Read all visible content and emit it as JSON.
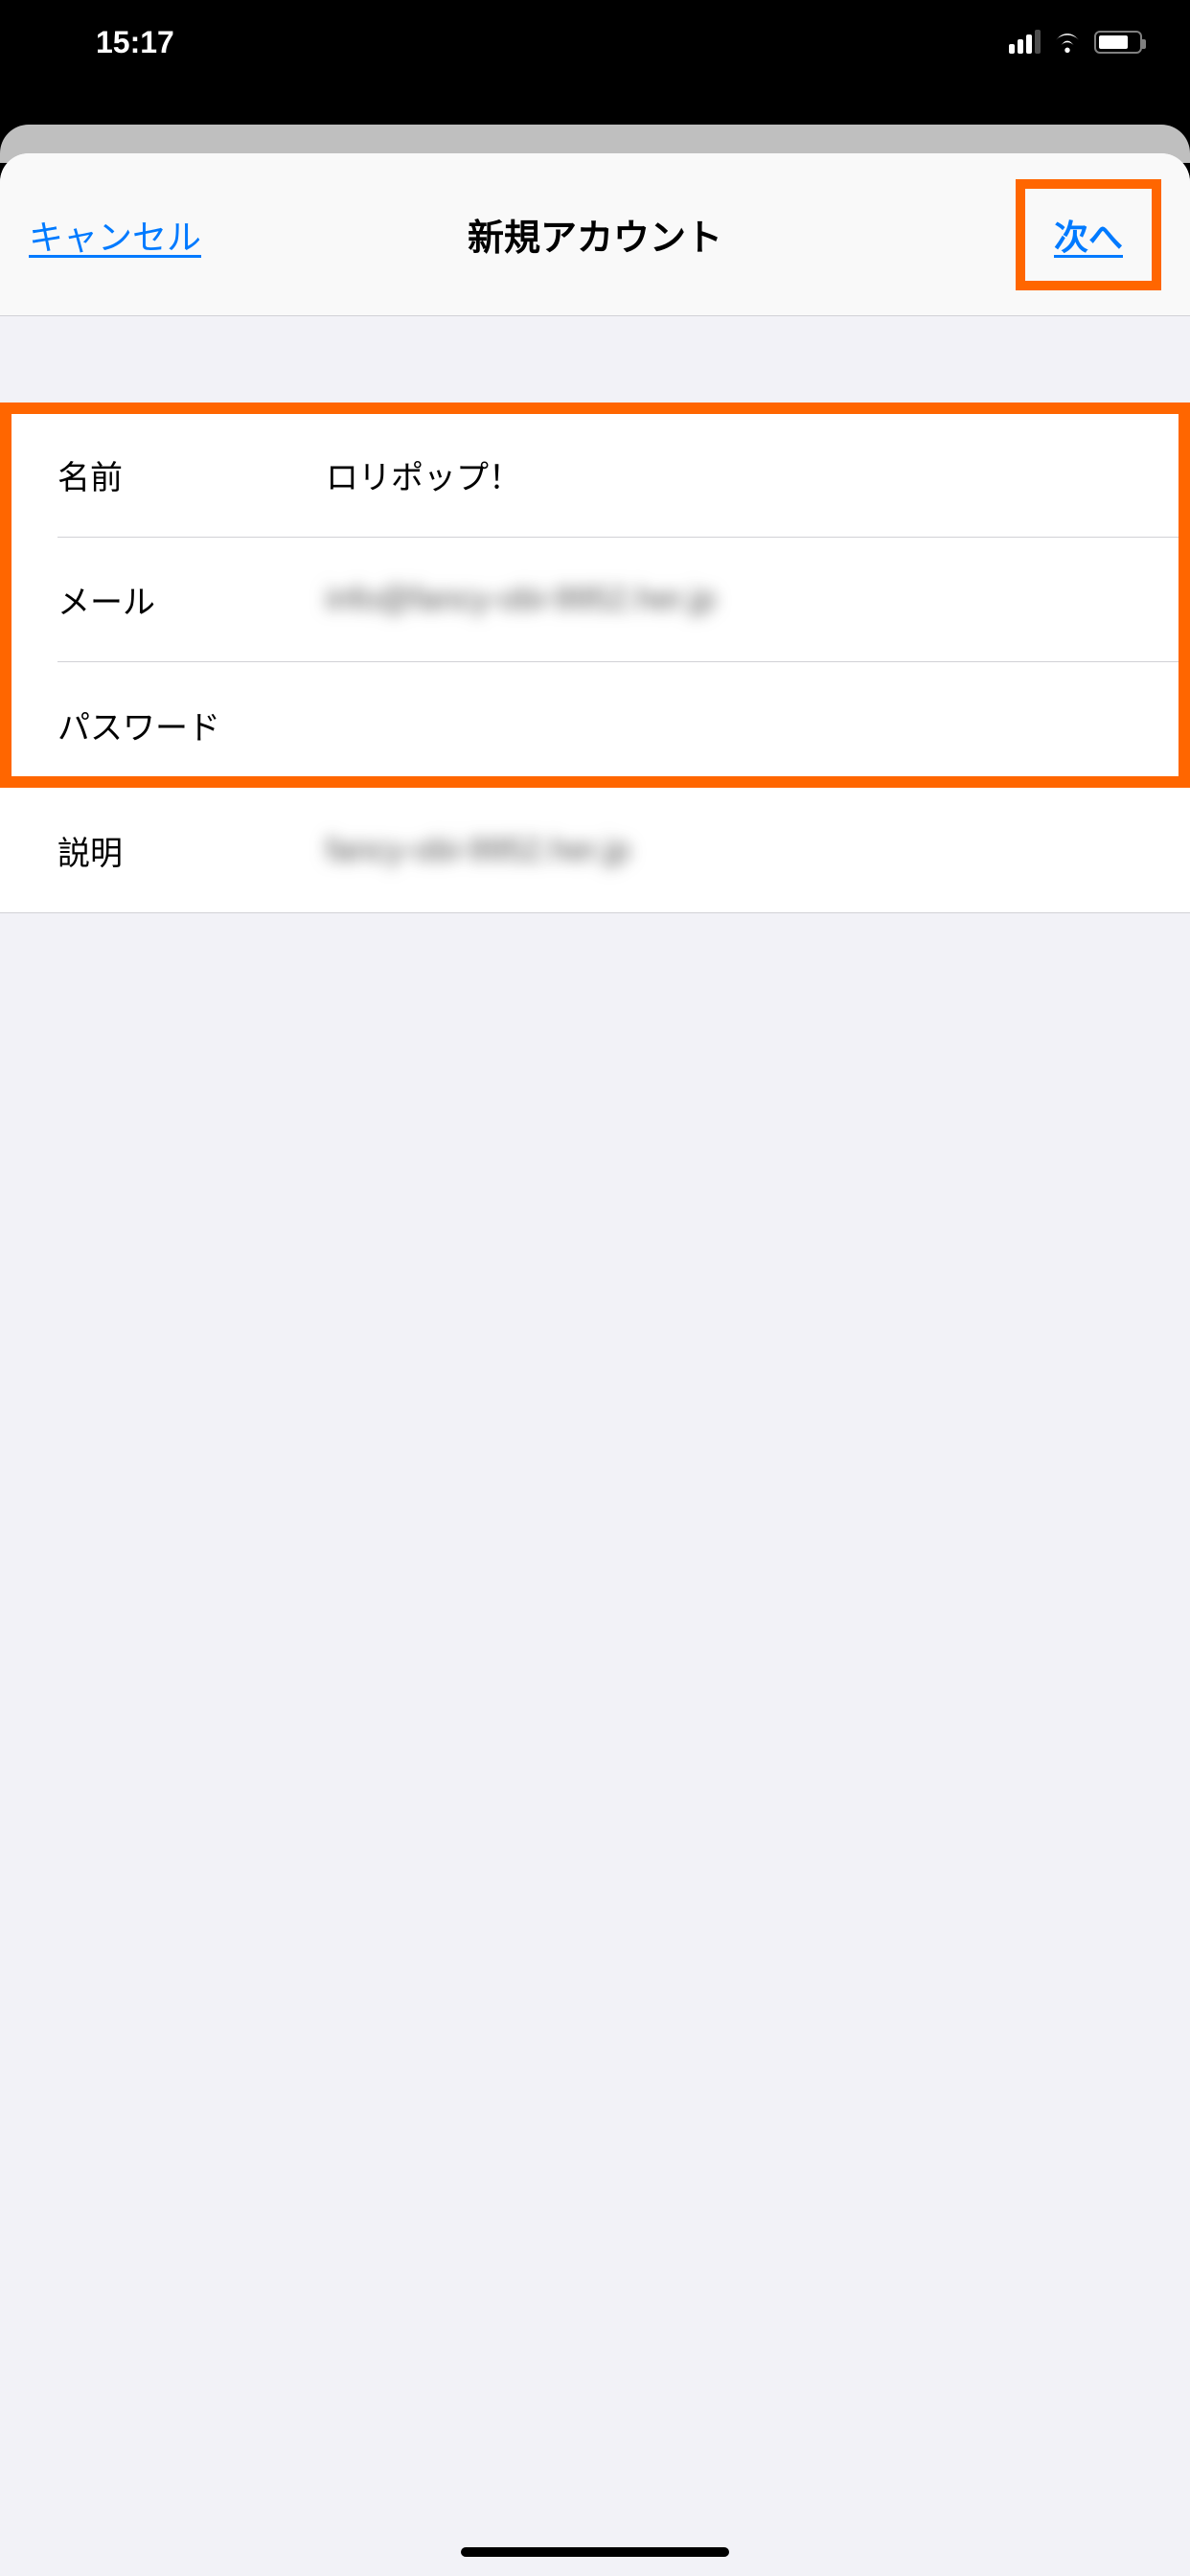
{
  "statusBar": {
    "time": "15:17"
  },
  "nav": {
    "cancel": "キャンセル",
    "title": "新規アカウント",
    "next": "次へ"
  },
  "form": {
    "name": {
      "label": "名前",
      "value": "ロリポップ！"
    },
    "mail": {
      "label": "メール",
      "value": "info@fancy-obi-9952.her.jp"
    },
    "password": {
      "label": "パスワード",
      "value": ""
    },
    "description": {
      "label": "説明",
      "value": "fancy-obi-9952.her.jp"
    }
  }
}
